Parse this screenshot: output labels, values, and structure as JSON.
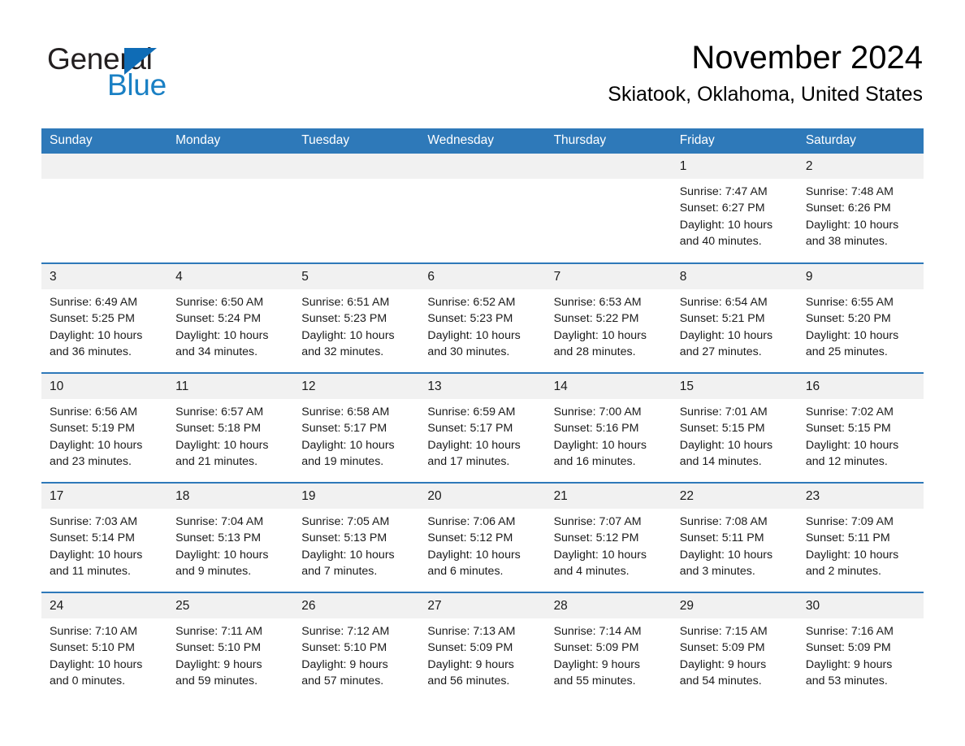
{
  "brand": {
    "name_part1": "General",
    "name_part2": "Blue",
    "triangle_color": "#0f6cb6",
    "blue_text_color": "#1a80c4"
  },
  "header": {
    "month_title": "November 2024",
    "location": "Skiatook, Oklahoma, United States"
  },
  "theme": {
    "header_blue": "#2e79b9",
    "daynum_gray": "#f1f1f1",
    "text_color": "#1a1a1a",
    "page_background": "#ffffff"
  },
  "calendar": {
    "weekday_headers": [
      "Sunday",
      "Monday",
      "Tuesday",
      "Wednesday",
      "Thursday",
      "Friday",
      "Saturday"
    ],
    "labels": {
      "sunrise": "Sunrise:",
      "sunset": "Sunset:",
      "daylight": "Daylight:"
    },
    "weeks": [
      [
        {
          "day": "",
          "blank": true
        },
        {
          "day": "",
          "blank": true
        },
        {
          "day": "",
          "blank": true
        },
        {
          "day": "",
          "blank": true
        },
        {
          "day": "",
          "blank": true
        },
        {
          "day": "1",
          "sunrise": "Sunrise: 7:47 AM",
          "sunset": "Sunset: 6:27 PM",
          "daylight_line1": "Daylight: 10 hours",
          "daylight_line2": "and 40 minutes."
        },
        {
          "day": "2",
          "sunrise": "Sunrise: 7:48 AM",
          "sunset": "Sunset: 6:26 PM",
          "daylight_line1": "Daylight: 10 hours",
          "daylight_line2": "and 38 minutes."
        }
      ],
      [
        {
          "day": "3",
          "sunrise": "Sunrise: 6:49 AM",
          "sunset": "Sunset: 5:25 PM",
          "daylight_line1": "Daylight: 10 hours",
          "daylight_line2": "and 36 minutes."
        },
        {
          "day": "4",
          "sunrise": "Sunrise: 6:50 AM",
          "sunset": "Sunset: 5:24 PM",
          "daylight_line1": "Daylight: 10 hours",
          "daylight_line2": "and 34 minutes."
        },
        {
          "day": "5",
          "sunrise": "Sunrise: 6:51 AM",
          "sunset": "Sunset: 5:23 PM",
          "daylight_line1": "Daylight: 10 hours",
          "daylight_line2": "and 32 minutes."
        },
        {
          "day": "6",
          "sunrise": "Sunrise: 6:52 AM",
          "sunset": "Sunset: 5:23 PM",
          "daylight_line1": "Daylight: 10 hours",
          "daylight_line2": "and 30 minutes."
        },
        {
          "day": "7",
          "sunrise": "Sunrise: 6:53 AM",
          "sunset": "Sunset: 5:22 PM",
          "daylight_line1": "Daylight: 10 hours",
          "daylight_line2": "and 28 minutes."
        },
        {
          "day": "8",
          "sunrise": "Sunrise: 6:54 AM",
          "sunset": "Sunset: 5:21 PM",
          "daylight_line1": "Daylight: 10 hours",
          "daylight_line2": "and 27 minutes."
        },
        {
          "day": "9",
          "sunrise": "Sunrise: 6:55 AM",
          "sunset": "Sunset: 5:20 PM",
          "daylight_line1": "Daylight: 10 hours",
          "daylight_line2": "and 25 minutes."
        }
      ],
      [
        {
          "day": "10",
          "sunrise": "Sunrise: 6:56 AM",
          "sunset": "Sunset: 5:19 PM",
          "daylight_line1": "Daylight: 10 hours",
          "daylight_line2": "and 23 minutes."
        },
        {
          "day": "11",
          "sunrise": "Sunrise: 6:57 AM",
          "sunset": "Sunset: 5:18 PM",
          "daylight_line1": "Daylight: 10 hours",
          "daylight_line2": "and 21 minutes."
        },
        {
          "day": "12",
          "sunrise": "Sunrise: 6:58 AM",
          "sunset": "Sunset: 5:17 PM",
          "daylight_line1": "Daylight: 10 hours",
          "daylight_line2": "and 19 minutes."
        },
        {
          "day": "13",
          "sunrise": "Sunrise: 6:59 AM",
          "sunset": "Sunset: 5:17 PM",
          "daylight_line1": "Daylight: 10 hours",
          "daylight_line2": "and 17 minutes."
        },
        {
          "day": "14",
          "sunrise": "Sunrise: 7:00 AM",
          "sunset": "Sunset: 5:16 PM",
          "daylight_line1": "Daylight: 10 hours",
          "daylight_line2": "and 16 minutes."
        },
        {
          "day": "15",
          "sunrise": "Sunrise: 7:01 AM",
          "sunset": "Sunset: 5:15 PM",
          "daylight_line1": "Daylight: 10 hours",
          "daylight_line2": "and 14 minutes."
        },
        {
          "day": "16",
          "sunrise": "Sunrise: 7:02 AM",
          "sunset": "Sunset: 5:15 PM",
          "daylight_line1": "Daylight: 10 hours",
          "daylight_line2": "and 12 minutes."
        }
      ],
      [
        {
          "day": "17",
          "sunrise": "Sunrise: 7:03 AM",
          "sunset": "Sunset: 5:14 PM",
          "daylight_line1": "Daylight: 10 hours",
          "daylight_line2": "and 11 minutes."
        },
        {
          "day": "18",
          "sunrise": "Sunrise: 7:04 AM",
          "sunset": "Sunset: 5:13 PM",
          "daylight_line1": "Daylight: 10 hours",
          "daylight_line2": "and 9 minutes."
        },
        {
          "day": "19",
          "sunrise": "Sunrise: 7:05 AM",
          "sunset": "Sunset: 5:13 PM",
          "daylight_line1": "Daylight: 10 hours",
          "daylight_line2": "and 7 minutes."
        },
        {
          "day": "20",
          "sunrise": "Sunrise: 7:06 AM",
          "sunset": "Sunset: 5:12 PM",
          "daylight_line1": "Daylight: 10 hours",
          "daylight_line2": "and 6 minutes."
        },
        {
          "day": "21",
          "sunrise": "Sunrise: 7:07 AM",
          "sunset": "Sunset: 5:12 PM",
          "daylight_line1": "Daylight: 10 hours",
          "daylight_line2": "and 4 minutes."
        },
        {
          "day": "22",
          "sunrise": "Sunrise: 7:08 AM",
          "sunset": "Sunset: 5:11 PM",
          "daylight_line1": "Daylight: 10 hours",
          "daylight_line2": "and 3 minutes."
        },
        {
          "day": "23",
          "sunrise": "Sunrise: 7:09 AM",
          "sunset": "Sunset: 5:11 PM",
          "daylight_line1": "Daylight: 10 hours",
          "daylight_line2": "and 2 minutes."
        }
      ],
      [
        {
          "day": "24",
          "sunrise": "Sunrise: 7:10 AM",
          "sunset": "Sunset: 5:10 PM",
          "daylight_line1": "Daylight: 10 hours",
          "daylight_line2": "and 0 minutes."
        },
        {
          "day": "25",
          "sunrise": "Sunrise: 7:11 AM",
          "sunset": "Sunset: 5:10 PM",
          "daylight_line1": "Daylight: 9 hours",
          "daylight_line2": "and 59 minutes."
        },
        {
          "day": "26",
          "sunrise": "Sunrise: 7:12 AM",
          "sunset": "Sunset: 5:10 PM",
          "daylight_line1": "Daylight: 9 hours",
          "daylight_line2": "and 57 minutes."
        },
        {
          "day": "27",
          "sunrise": "Sunrise: 7:13 AM",
          "sunset": "Sunset: 5:09 PM",
          "daylight_line1": "Daylight: 9 hours",
          "daylight_line2": "and 56 minutes."
        },
        {
          "day": "28",
          "sunrise": "Sunrise: 7:14 AM",
          "sunset": "Sunset: 5:09 PM",
          "daylight_line1": "Daylight: 9 hours",
          "daylight_line2": "and 55 minutes."
        },
        {
          "day": "29",
          "sunrise": "Sunrise: 7:15 AM",
          "sunset": "Sunset: 5:09 PM",
          "daylight_line1": "Daylight: 9 hours",
          "daylight_line2": "and 54 minutes."
        },
        {
          "day": "30",
          "sunrise": "Sunrise: 7:16 AM",
          "sunset": "Sunset: 5:09 PM",
          "daylight_line1": "Daylight: 9 hours",
          "daylight_line2": "and 53 minutes."
        }
      ]
    ]
  }
}
